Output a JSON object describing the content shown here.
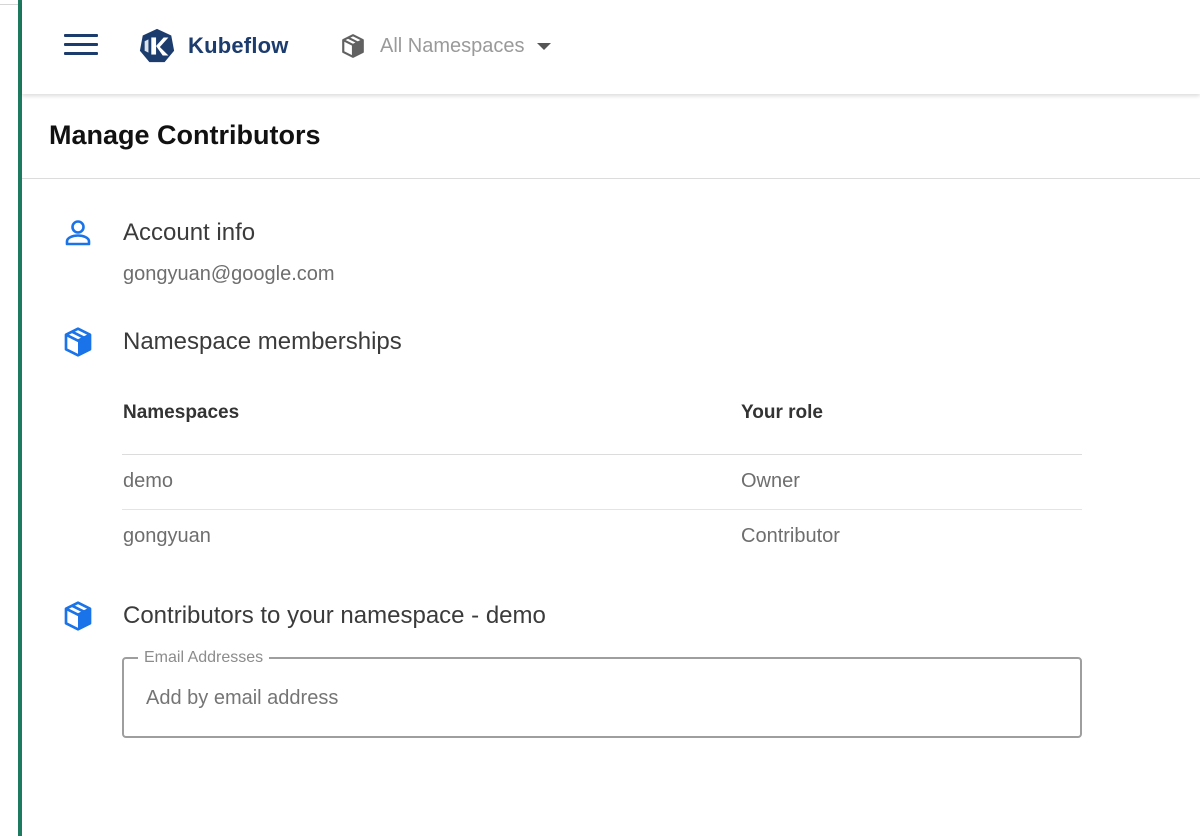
{
  "header": {
    "app_name": "Kubeflow",
    "namespace_selector": "All Namespaces"
  },
  "page": {
    "title": "Manage Contributors"
  },
  "account": {
    "heading": "Account info",
    "email": "gongyuan@google.com"
  },
  "memberships": {
    "heading": "Namespace memberships",
    "columns": [
      "Namespaces",
      "Your role"
    ],
    "rows": [
      {
        "namespace": "demo",
        "role": "Owner"
      },
      {
        "namespace": "gongyuan",
        "role": "Contributor"
      }
    ]
  },
  "contributors": {
    "heading": "Contributors to your namespace - demo",
    "field_label": "Email Addresses",
    "field_placeholder": "Add by email address"
  },
  "colors": {
    "brand_navy": "#1d3c6e",
    "accent_blue": "#1a73e8",
    "left_border": "#1e7a5e"
  },
  "icons": {
    "menu": "hamburger-menu-icon",
    "logo": "kubeflow-logo-icon",
    "namespace": "package-icon",
    "account": "person-icon",
    "membership": "package-icon",
    "contributors": "package-icon"
  }
}
